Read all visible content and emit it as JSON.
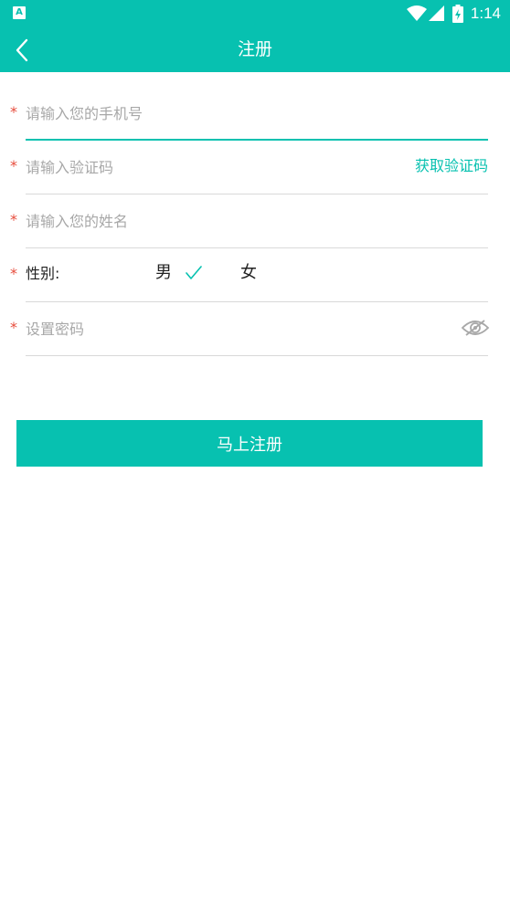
{
  "status_bar": {
    "time": "1:14",
    "badge": "A"
  },
  "app_bar": {
    "title": "注册"
  },
  "form": {
    "required_mark": "*",
    "phone": {
      "placeholder": "请输入您的手机号",
      "value": ""
    },
    "code": {
      "placeholder": "请输入验证码",
      "value": "",
      "get_code_label": "获取验证码"
    },
    "name": {
      "placeholder": "请输入您的姓名",
      "value": ""
    },
    "gender": {
      "label": "性别:",
      "male": "男",
      "female": "女",
      "selected": "男"
    },
    "password": {
      "placeholder": "设置密码",
      "value": ""
    }
  },
  "submit_label": "马上注册",
  "colors": {
    "accent": "#07c1b0",
    "required": "#e74c3c",
    "divider": "#d9d9d9",
    "placeholder": "#a8a8a8"
  },
  "icons": [
    "back-arrow-icon",
    "wifi-icon",
    "signal-icon",
    "battery-icon",
    "check-icon",
    "eye-icon"
  ]
}
